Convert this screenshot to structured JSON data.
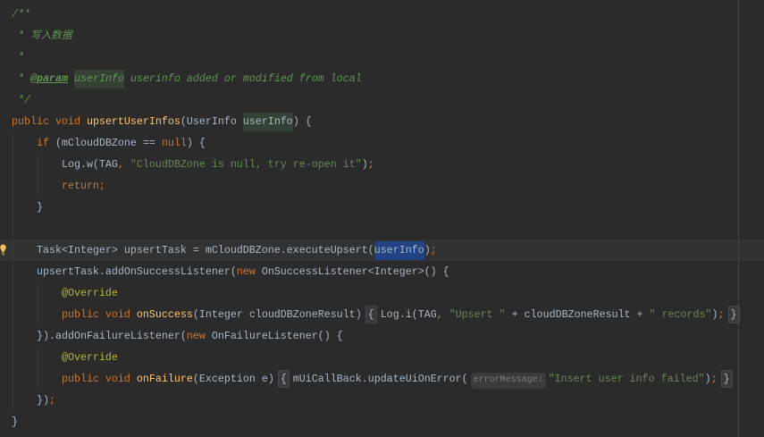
{
  "theme": {
    "background": "#2B2B2B",
    "current_line": "#323232",
    "text": "#A9B7C6",
    "keyword": "#CC7832",
    "method_declaration": "#FFC66D",
    "string": "#6A8759",
    "doc_comment": "#629755",
    "annotation": "#BBB529",
    "selection": "#214283",
    "identifier_highlight": "#344134",
    "inlay_hint_text": "#7E7E7E",
    "inlay_hint_background": "#3B3B3B",
    "folded_region": "#3A3A3A",
    "lightbulb": "#F0C050",
    "indent_guide": "#3A3A3A",
    "margin_guide": "#444444"
  },
  "editor": {
    "lines": [
      {
        "tokens": [
          {
            "doc": "/**"
          }
        ]
      },
      {
        "tokens": [
          {
            "doc": " * 写入数据"
          }
        ]
      },
      {
        "tokens": [
          {
            "doc": " *"
          }
        ]
      },
      {
        "tokens": [
          {
            "doc": " * "
          },
          {
            "doc_tag": "@param"
          },
          {
            "doc": " "
          },
          {
            "doc_param": "userInfo"
          },
          {
            "doc": " userinfo added or modified from local"
          }
        ]
      },
      {
        "tokens": [
          {
            "doc": " */"
          }
        ]
      },
      {
        "tokens": [
          {
            "keyword": "public void "
          },
          {
            "method": "upsertUserInfos"
          },
          {
            "text": "(UserInfo "
          },
          {
            "param_ref": "userInfo"
          },
          {
            "text": ") {"
          }
        ]
      },
      {
        "tokens": [
          {
            "keyword": "    if"
          },
          {
            "text": " (mCloudDBZone == "
          },
          {
            "keyword": "null"
          },
          {
            "text": ") {"
          }
        ]
      },
      {
        "tokens": [
          {
            "text": "        Log.w(TAG"
          },
          {
            "punct": ", "
          },
          {
            "string": "\"CloudDBZone is null, try re-open it\""
          },
          {
            "text": ")"
          },
          {
            "punct": ";"
          }
        ]
      },
      {
        "tokens": [
          {
            "keyword": "        return;"
          }
        ]
      },
      {
        "tokens": [
          {
            "text": "    }"
          }
        ]
      },
      {
        "tokens": []
      },
      {
        "current": true,
        "gutter_icon": "lightbulb-icon",
        "tokens": [
          {
            "text": "    Task<Integer> upsertTask = mCloudDBZone.executeUpsert("
          },
          {
            "selection": "userInfo"
          },
          {
            "text": ")"
          },
          {
            "punct": ";"
          }
        ]
      },
      {
        "tokens": [
          {
            "text": "    upsertTask.addOnSuccessListener("
          },
          {
            "keyword": "new"
          },
          {
            "text": " OnSuccessListener<Integer>() {"
          }
        ]
      },
      {
        "tokens": [
          {
            "annotation": "        @Override"
          }
        ]
      },
      {
        "tokens": [
          {
            "keyword": "        public void "
          },
          {
            "method": "onSuccess"
          },
          {
            "text": "(Integer cloudDBZoneResult) "
          },
          {
            "fold": "{"
          },
          {
            "text": " Log.i(TAG"
          },
          {
            "punct": ", "
          },
          {
            "string": "\"Upsert \""
          },
          {
            "text": " + cloudDBZoneResult + "
          },
          {
            "string": "\" records\""
          },
          {
            "text": ")"
          },
          {
            "punct": "; "
          },
          {
            "fold": "}"
          }
        ]
      },
      {
        "tokens": [
          {
            "text": "    }).addOnFailureListener("
          },
          {
            "keyword": "new"
          },
          {
            "text": " OnFailureListener() {"
          }
        ]
      },
      {
        "tokens": [
          {
            "annotation": "        @Override"
          }
        ]
      },
      {
        "tokens": [
          {
            "keyword": "        public void "
          },
          {
            "method": "onFailure"
          },
          {
            "text": "(Exception e) "
          },
          {
            "fold": "{"
          },
          {
            "text": " mUiCallBack.updateUiOnError("
          },
          {
            "hint": "errorMessage:"
          },
          {
            "string": "\"Insert user info failed\""
          },
          {
            "text": ")"
          },
          {
            "punct": "; "
          },
          {
            "fold": "}"
          }
        ]
      },
      {
        "tokens": [
          {
            "text": "    })"
          },
          {
            "punct": ";"
          }
        ]
      },
      {
        "tokens": [
          {
            "text": "}"
          }
        ]
      }
    ]
  }
}
